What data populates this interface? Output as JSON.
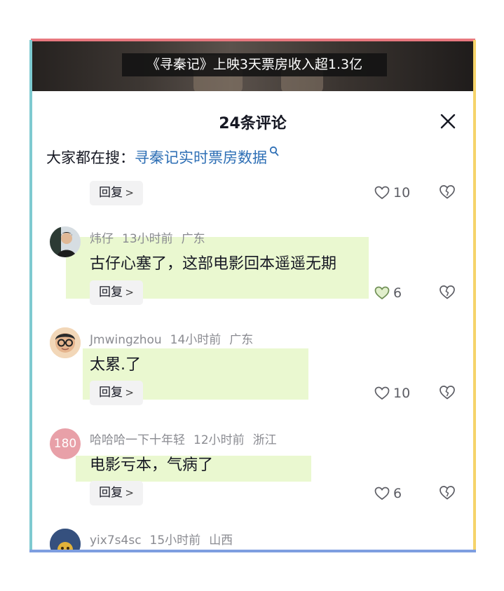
{
  "video": {
    "caption": "《寻秦记》上映3天票房收入超1.3亿"
  },
  "sheet": {
    "title": "24条评论"
  },
  "search": {
    "prefix": "大家都在搜：",
    "term": "寻秦记实时票房数据"
  },
  "reply_label": "回复",
  "partial_comment": {
    "likes": "10"
  },
  "comments": [
    {
      "user": "炜仔",
      "time": "13小时前",
      "region": "广东",
      "text": "古仔心塞了，这部电影回本遥遥无期",
      "likes": "6",
      "liked_style": "green"
    },
    {
      "user": "Jmwingzhou",
      "time": "14小时前",
      "region": "广东",
      "text": "太累.了",
      "likes": "10"
    },
    {
      "user": "哈哈哈一下十年轻",
      "time": "12小时前",
      "region": "浙江",
      "text": "电影亏本，气病了",
      "likes": "6",
      "avatar_text": "180"
    },
    {
      "user": "yix7s4sc",
      "time": "15小时前",
      "region": "山西"
    }
  ],
  "colors": {
    "accent_link": "#2e6fb5",
    "avatar_pink": "#e8a0a8",
    "highlight": "#d0f096"
  }
}
